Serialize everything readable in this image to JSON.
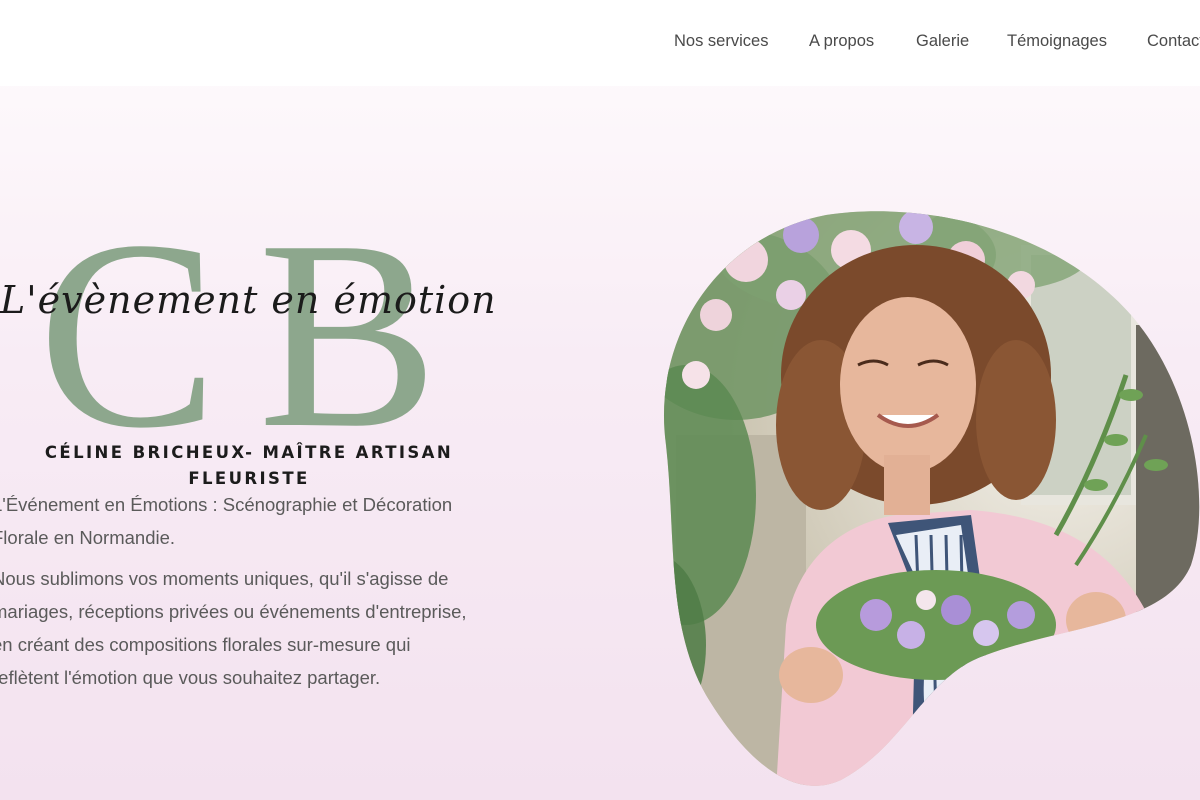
{
  "nav": {
    "items": [
      {
        "label": "Nos services"
      },
      {
        "label": "A propos"
      },
      {
        "label": "Galerie"
      },
      {
        "label": "Témoignages"
      },
      {
        "label": "Contact"
      }
    ]
  },
  "logo": {
    "monogram_c": "C",
    "monogram_b": "B",
    "tagline": "L'évènement en émotion",
    "subtitle": "CÉLINE BRICHEUX- MAÎTRE ARTISAN FLEURISTE"
  },
  "hero": {
    "paragraph1": "L'Événement en Émotions : Scénographie et Décoration Florale en Normandie.",
    "paragraph2": "Nous sublimons vos moments uniques, qu'il s'agisse de mariages, réceptions privées ou événements d'entreprise, en créant des compositions florales sur-mesure qui reflètent l'émotion que vous souhaitez partager."
  },
  "colors": {
    "monogram": "#8da78d",
    "background_top": "#ffffff",
    "background_bottom": "#f3e2ef",
    "nav_text": "#4a4a4a",
    "body_text": "#5a5a5a"
  }
}
